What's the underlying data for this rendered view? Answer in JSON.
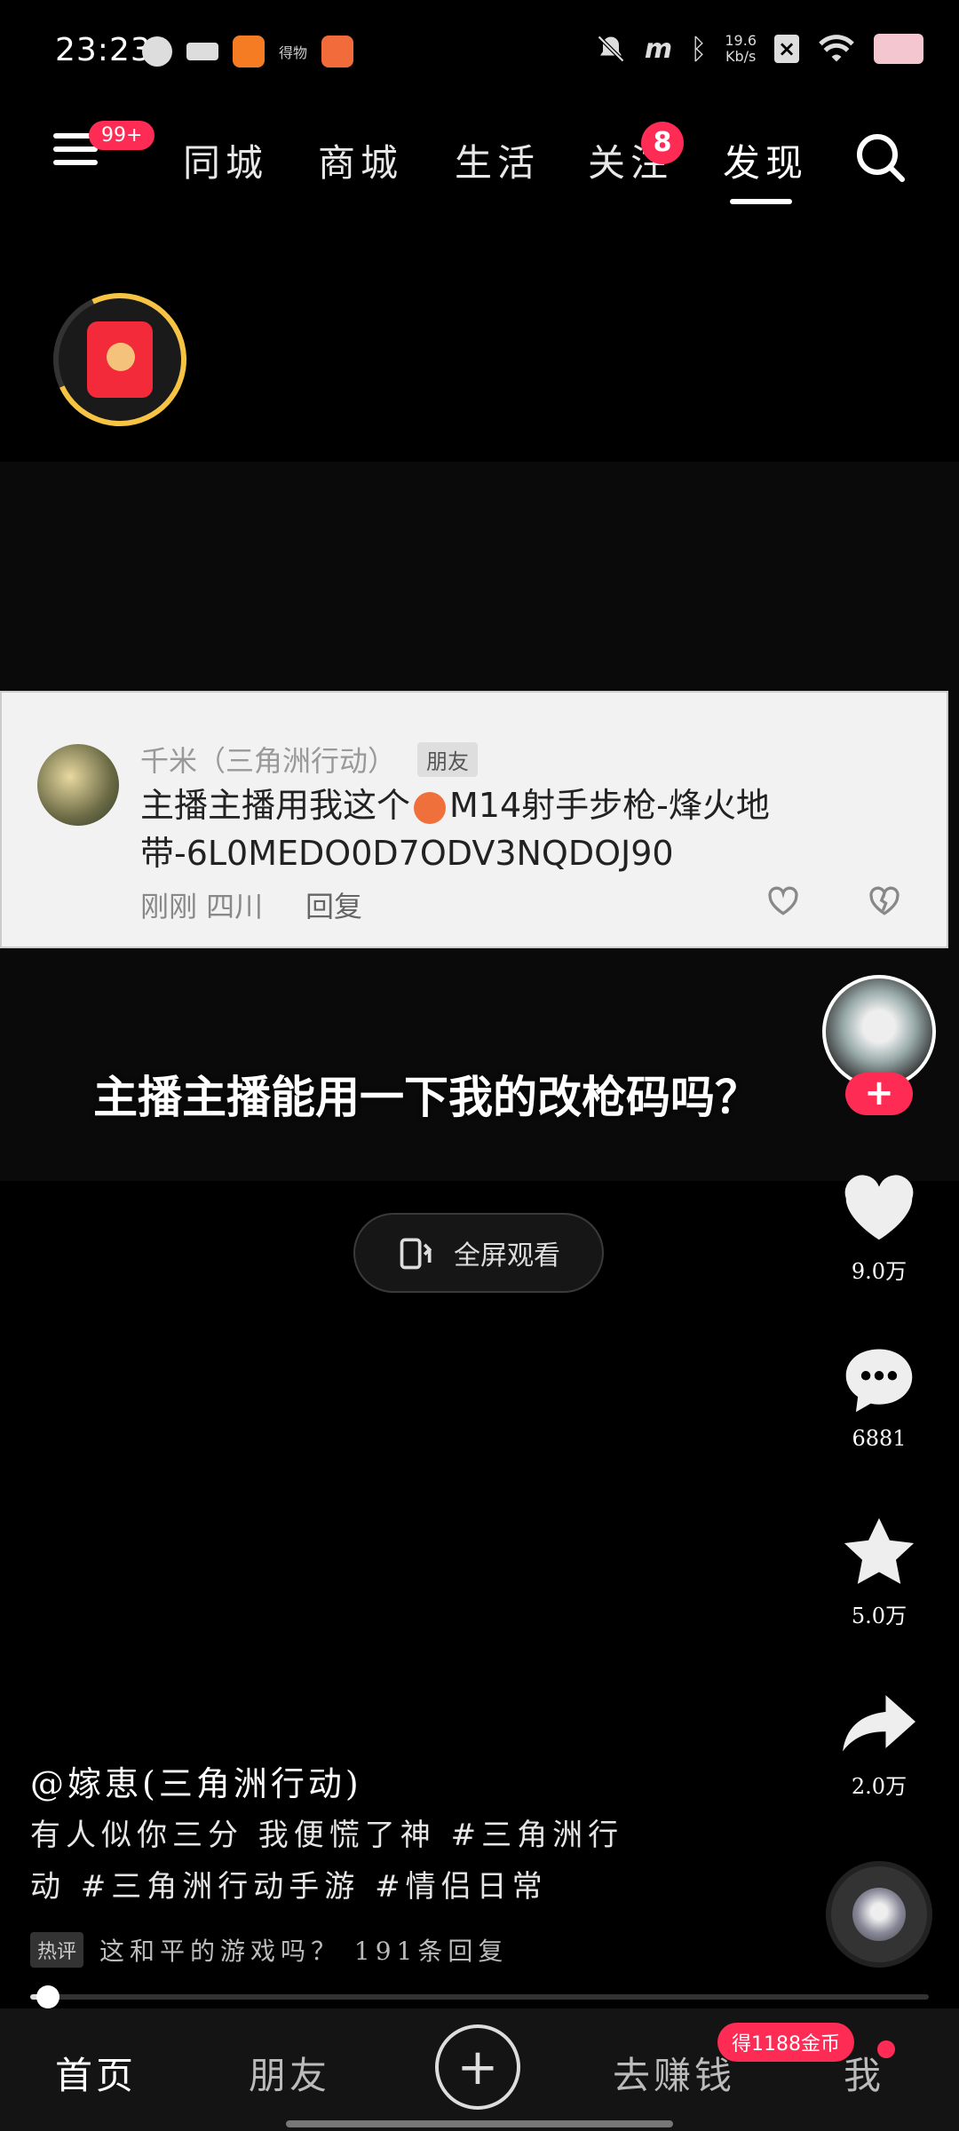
{
  "status_bar": {
    "time": "23:23",
    "app_label": "得物",
    "net_speed_value": "19.6",
    "net_speed_unit": "Kb/s"
  },
  "top_nav": {
    "menu_badge": "99+",
    "tabs": [
      {
        "label": "同城",
        "active": false
      },
      {
        "label": "商城",
        "active": false
      },
      {
        "label": "生活",
        "active": false
      },
      {
        "label": "关注",
        "active": false,
        "badge": "8"
      },
      {
        "label": "发现",
        "active": true
      }
    ]
  },
  "video": {
    "comment_card": {
      "username": "千米（三角洲行动）",
      "tag": "朋友",
      "text_before_emoji": "主播主播用我这个",
      "text_after_emoji": "M14射手步枪-烽火地带-6L0MEDO0D7ODV3NQDOJ90",
      "meta": "刚刚 四川",
      "reply": "回复"
    },
    "subtitle": "主播主播能用一下我的改枪码吗？",
    "fullscreen_label": "全屏观看"
  },
  "right_rail": {
    "follow_label": "+",
    "likes": "9.0万",
    "comments": "6881",
    "favorites": "5.0万",
    "shares": "2.0万"
  },
  "caption": {
    "author": "@嫁恵(三角洲行动)",
    "text": "有人似你三分 我便慌了神 #三角洲行动 #三角洲行动手游 #情侣日常",
    "hot_tag": "热评",
    "hot_comment": "这和平的游戏吗？ 191条回复"
  },
  "progress": {
    "fraction": 0.02
  },
  "bottom_nav": {
    "home": "首页",
    "friends": "朋友",
    "plus": "+",
    "earn": "去赚钱",
    "earn_badge": "得1188金币",
    "me": "我"
  },
  "colors": {
    "accent": "#fe2c55",
    "background": "#000000",
    "ring": "#f6c343"
  }
}
